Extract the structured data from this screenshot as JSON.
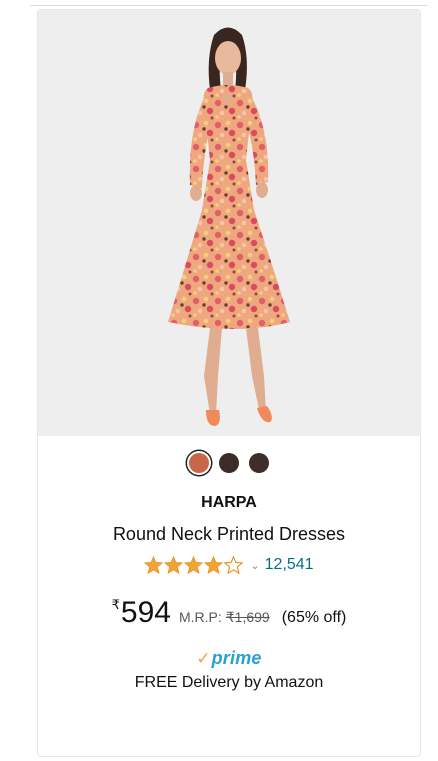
{
  "product": {
    "image_alt": "Woman wearing a round neck floral printed midi dress",
    "colors": [
      {
        "name": "rust-orange",
        "hex": "#c8664a",
        "selected": true
      },
      {
        "name": "dark-brown",
        "hex": "#3b2c28",
        "selected": false
      },
      {
        "name": "chocolate-brown",
        "hex": "#3e2e2a",
        "selected": false
      }
    ],
    "brand": "HARPA",
    "title": "Round Neck Printed Dresses",
    "rating": {
      "stars": 4,
      "out_of": 5,
      "count": "12,541",
      "star_color": "#f0a43a"
    },
    "price": {
      "currency": "₹",
      "amount": "594",
      "mrp_label": "M.R.P:",
      "mrp_value": "₹1,699",
      "discount": "(65% off)"
    },
    "prime": {
      "check": "✓",
      "label": "prime"
    },
    "delivery": "FREE Delivery by Amazon"
  }
}
